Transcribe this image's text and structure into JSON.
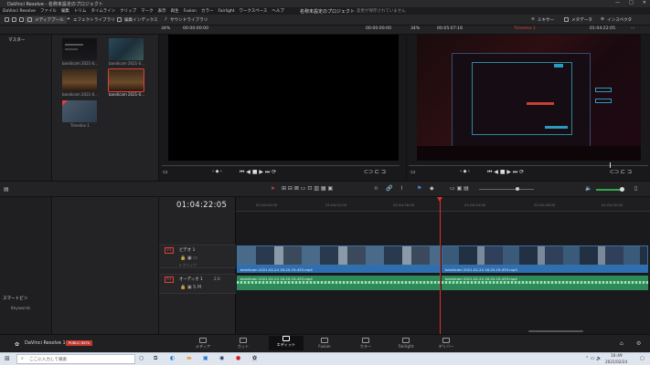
{
  "window": {
    "app_name": "DaVinci Resolve",
    "project_suffix": "- 名称未設定のプロジェクト",
    "min": "—",
    "max": "□",
    "close": "✕"
  },
  "menu": {
    "items": [
      "DaVinci Resolve",
      "ファイル",
      "編集",
      "トリム",
      "タイムライン",
      "クリップ",
      "マーク",
      "表示",
      "再生",
      "Fusion",
      "カラー",
      "Fairlight",
      "ワークスペース",
      "ヘルプ"
    ],
    "project_title": "名称未設定のプロジェクト",
    "save_status": "変更が保存されていません"
  },
  "toolbar": {
    "media_pool": "メディアプール",
    "effects_library": "エフェクトライブラリ",
    "edit_index": "編集インデックス",
    "sound_library": "サウンドライブラリ",
    "mixer": "ミキサー",
    "metadata": "メタデータ",
    "inspector": "インスペクタ"
  },
  "viewer": {
    "src_zoom": "34%",
    "src_tc_left": "00:00:00:00",
    "src_tc_right": "00:00:00:00",
    "tl_zoom": "34%",
    "tl_duration": "00:05:07:16",
    "tl_name": "Timeline 1",
    "tl_timecode": "01:04:22:05"
  },
  "bins": {
    "root": "マスター",
    "smart_bins": "スマートビン",
    "keywords": "Keywords"
  },
  "media": {
    "clips": [
      {
        "name": "bandicam 2021-0..."
      },
      {
        "name": "bandicam 2021-0..."
      },
      {
        "name": "bandicam 2021-0..."
      },
      {
        "name": "bandicam 2021-0..."
      },
      {
        "name": "Timeline 1"
      }
    ]
  },
  "timeline": {
    "timecode": "01:04:22:05",
    "ruler": [
      "01:04:00:00",
      "01:04:12:00",
      "01:04:16:00",
      "01:04:24:00",
      "01:04:28:00",
      "01:04:32:00"
    ],
    "tracks": [
      {
        "id": "V1",
        "name": "ビデオ 1",
        "sub": "2 クリップ"
      },
      {
        "id": "A1",
        "name": "オーディオ 1",
        "level": "2.0"
      }
    ],
    "clips": {
      "audio_a": "bandicam 2021-02-24 16-20-19-453.mp4",
      "audio_b": "bandicam 2021-02-24 16-20-19-453.mp4",
      "audio_c": "bandicam 2021-02-24 16-20-19-453.mp4",
      "audio_d": "bandicam 2021-02-24 16-20-19-453.mp4"
    }
  },
  "branding": {
    "product": "DaVinci Resolve 17",
    "badge": "PUBLIC BETA"
  },
  "pages": [
    "メディア",
    "カット",
    "エディット",
    "Fusion",
    "カラー",
    "Fairlight",
    "デリバー"
  ],
  "taskbar": {
    "search_placeholder": "ここに入力して検索",
    "time": "16:49",
    "date": "2021/02/24"
  },
  "colors": {
    "accent_red": "#e0403a",
    "playhead": "#d8332c",
    "clip_blue": "#2d6fb0",
    "clip_green": "#2f8a5a"
  }
}
